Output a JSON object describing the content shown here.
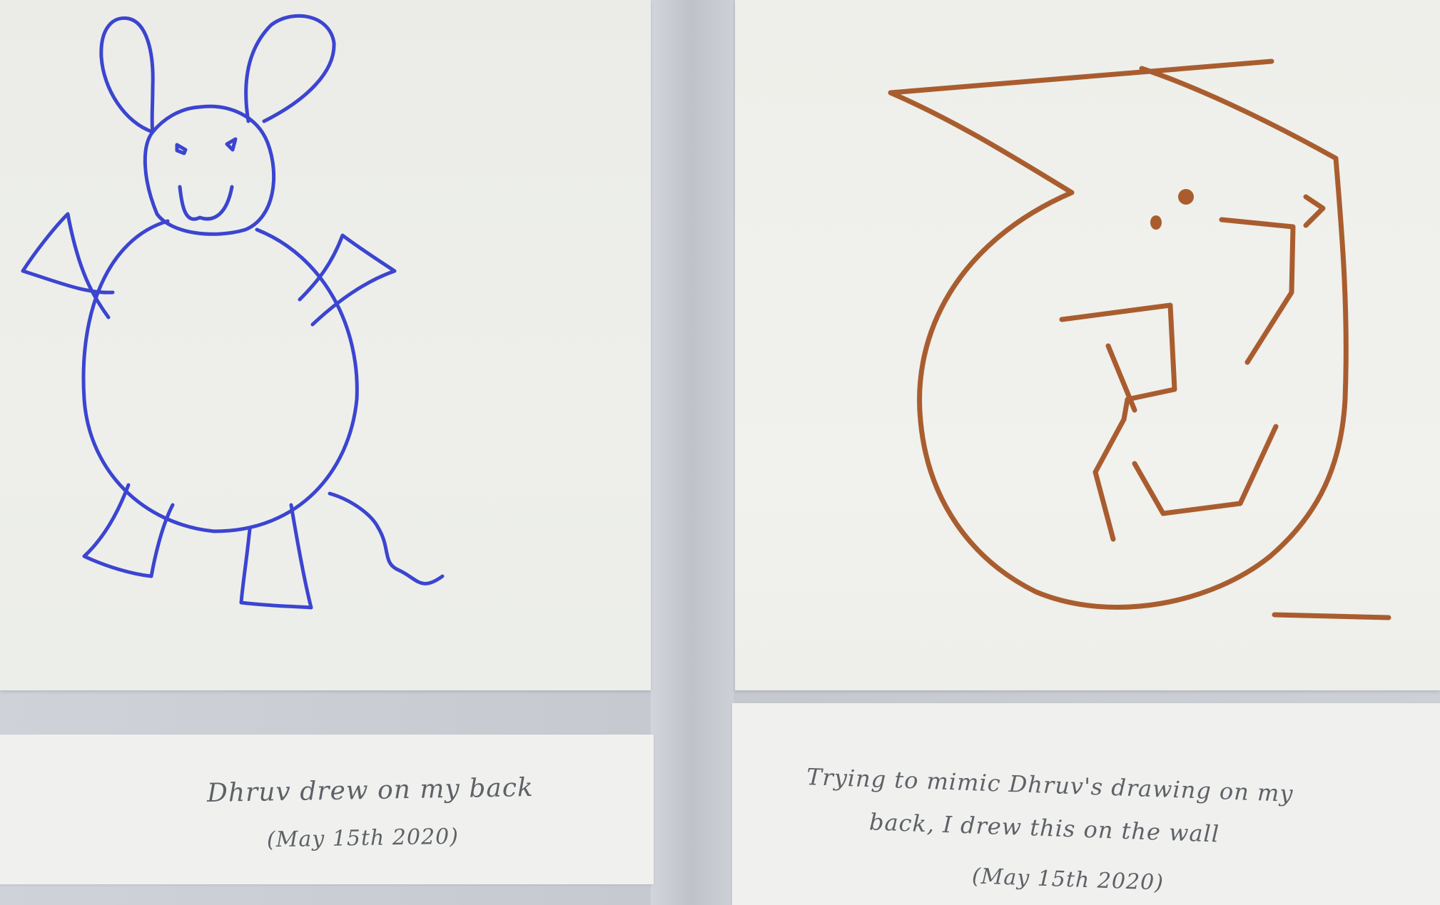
{
  "colors": {
    "left_drawing_ink": "#3b45d0",
    "right_drawing_ink": "#a95d2f",
    "caption_ink": "#5e6168"
  },
  "left_card": {
    "line1": "Dhruv drew on my back",
    "line2": "(May 15th 2020)"
  },
  "right_card": {
    "line1": "Trying to mimic Dhruv's drawing on my",
    "line2": "back, I drew this on the wall",
    "line3": "(May 15th 2020)"
  }
}
